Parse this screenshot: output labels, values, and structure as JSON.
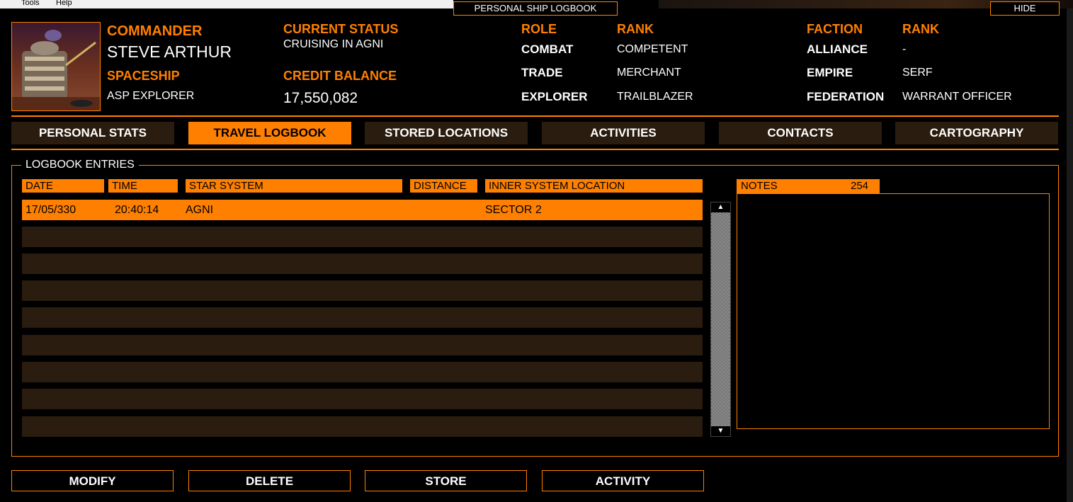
{
  "menu": {
    "tools": "Tools",
    "help": "Help"
  },
  "window": {
    "title": "PERSONAL SHIP LOGBOOK",
    "hide_label": "HIDE"
  },
  "commander": {
    "label": "COMMANDER",
    "name": "STEVE ARTHUR",
    "ship_label": "SPACESHIP",
    "ship": "ASP EXPLORER"
  },
  "status": {
    "label": "CURRENT STATUS",
    "value": "CRUISING IN AGNI",
    "credit_label": "CREDIT BALANCE",
    "credit": "17,550,082"
  },
  "roles": {
    "role_header": "ROLE",
    "rank_header": "RANK",
    "items": [
      {
        "role": "COMBAT",
        "rank": "COMPETENT"
      },
      {
        "role": "TRADE",
        "rank": "MERCHANT"
      },
      {
        "role": "EXPLORER",
        "rank": "TRAILBLAZER"
      }
    ]
  },
  "factions": {
    "faction_header": "FACTION",
    "rank_header": "RANK",
    "items": [
      {
        "faction": "ALLIANCE",
        "rank": "-"
      },
      {
        "faction": "EMPIRE",
        "rank": "SERF"
      },
      {
        "faction": "FEDERATION",
        "rank": "WARRANT OFFICER"
      }
    ]
  },
  "tabs": [
    {
      "label": "PERSONAL STATS",
      "active": false
    },
    {
      "label": "TRAVEL LOGBOOK",
      "active": true
    },
    {
      "label": "STORED LOCATIONS",
      "active": false
    },
    {
      "label": "ACTIVITIES",
      "active": false
    },
    {
      "label": "CONTACTS",
      "active": false
    },
    {
      "label": "CARTOGRAPHY",
      "active": false
    }
  ],
  "logbook": {
    "title": "LOGBOOK ENTRIES",
    "columns": [
      "DATE",
      "TIME",
      "STAR SYSTEM",
      "DISTANCE",
      "INNER SYSTEM LOCATION"
    ],
    "rows": [
      {
        "date": "17/05/330",
        "time": "20:40:14",
        "system": "AGNI",
        "distance": "",
        "location": "SECTOR 2"
      }
    ]
  },
  "notes": {
    "label": "NOTES",
    "count": "254"
  },
  "buttons": {
    "modify": "MODIFY",
    "delete": "DELETE",
    "store": "STORE",
    "activity": "ACTIVITY"
  },
  "colors": {
    "accent": "#ff8000",
    "row_bg": "#2a1c0e",
    "background": "#000000"
  },
  "icons": {
    "scroll_up": "▲",
    "scroll_down": "▼"
  }
}
